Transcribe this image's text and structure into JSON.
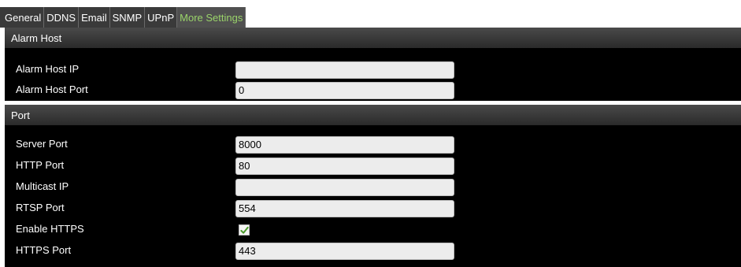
{
  "tabs": [
    {
      "label": "General"
    },
    {
      "label": "DDNS"
    },
    {
      "label": "Email"
    },
    {
      "label": "SNMP"
    },
    {
      "label": "UPnP"
    },
    {
      "label": "More Settings"
    }
  ],
  "sections": {
    "alarm_host": {
      "title": "Alarm Host",
      "fields": {
        "ip": {
          "label": "Alarm Host IP",
          "value": ""
        },
        "port": {
          "label": "Alarm Host Port",
          "value": "0"
        }
      }
    },
    "port": {
      "title": "Port",
      "fields": {
        "server_port": {
          "label": "Server Port",
          "value": "8000"
        },
        "http_port": {
          "label": "HTTP Port",
          "value": "80"
        },
        "multicast_ip": {
          "label": "Multicast IP",
          "value": ""
        },
        "rtsp_port": {
          "label": "RTSP Port",
          "value": "554"
        },
        "enable_https": {
          "label": "Enable HTTPS",
          "checked": true
        },
        "https_port": {
          "label": "HTTPS Port",
          "value": "443"
        }
      }
    }
  },
  "colors": {
    "active_tab_text": "#9ad36a",
    "panel_bg": "#000000",
    "check_mark": "#4a9a2a"
  }
}
